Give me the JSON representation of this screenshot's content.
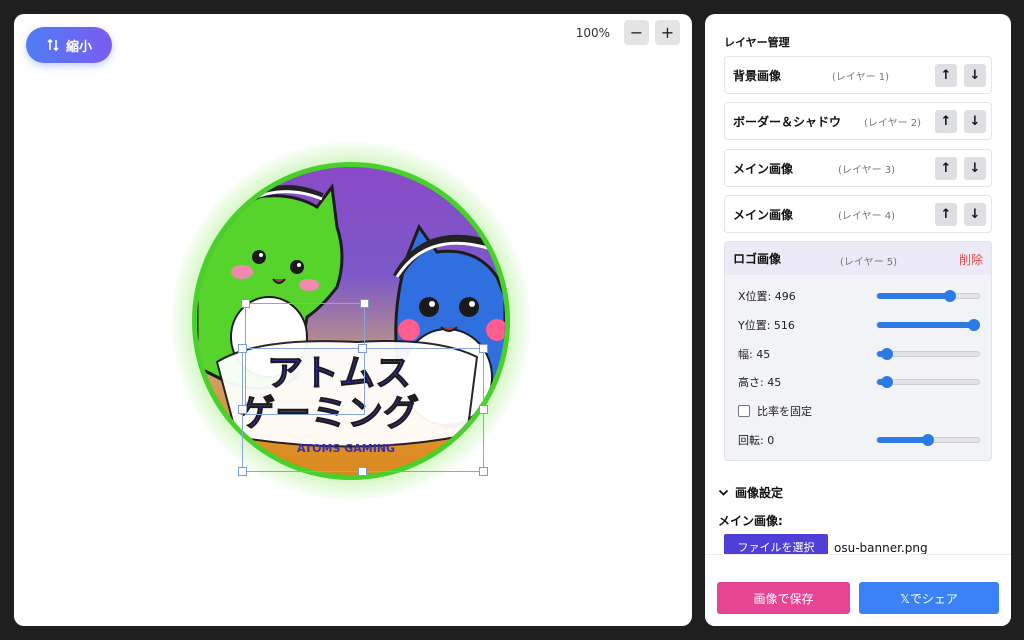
{
  "canvas": {
    "shrink_label": "縮小",
    "zoom_level": "100%",
    "zoom_out": "−",
    "zoom_in": "+",
    "logo_title_line1": "アトムス",
    "logo_title_line2": "ゲーミング",
    "logo_subtitle": "ATOMS GAMING"
  },
  "sidebar": {
    "title": "レイヤー管理",
    "up_arrow": "↑",
    "down_arrow": "↓",
    "layers": [
      {
        "name": "背景画像",
        "num": "(レイヤー 1)"
      },
      {
        "name": "ボーダー＆シャドウ",
        "num": "(レイヤー 2)"
      },
      {
        "name": "メイン画像",
        "num": "(レイヤー 3)"
      },
      {
        "name": "メイン画像",
        "num": "(レイヤー 4)"
      }
    ],
    "active_layer": {
      "name": "ロゴ画像",
      "num": "(レイヤー 5)",
      "delete_label": "削除",
      "props": {
        "x": {
          "label": "X位置: 496",
          "fraction": 0.72
        },
        "y": {
          "label": "Y位置: 516",
          "fraction": 0.95
        },
        "w": {
          "label": "幅: 45",
          "fraction": 0.1
        },
        "h": {
          "label": "高さ: 45",
          "fraction": 0.1
        },
        "lock": {
          "label": "比率を固定",
          "checked": false
        },
        "rot": {
          "label": "回転: 0",
          "fraction": 0.5
        }
      }
    },
    "image_settings": {
      "heading": "画像設定",
      "main_image_label": "メイン画像:",
      "file_button": "ファイルを選択",
      "file_name": "osu-banner.png"
    },
    "footer": {
      "save_label": "画像で保存",
      "share_label": "𝕏でシェア"
    }
  },
  "colors": {
    "accent_blue": "#3b82f6",
    "save_pink": "#e64593",
    "delete_red": "#e24a4a",
    "border_green": "#47d12a"
  }
}
